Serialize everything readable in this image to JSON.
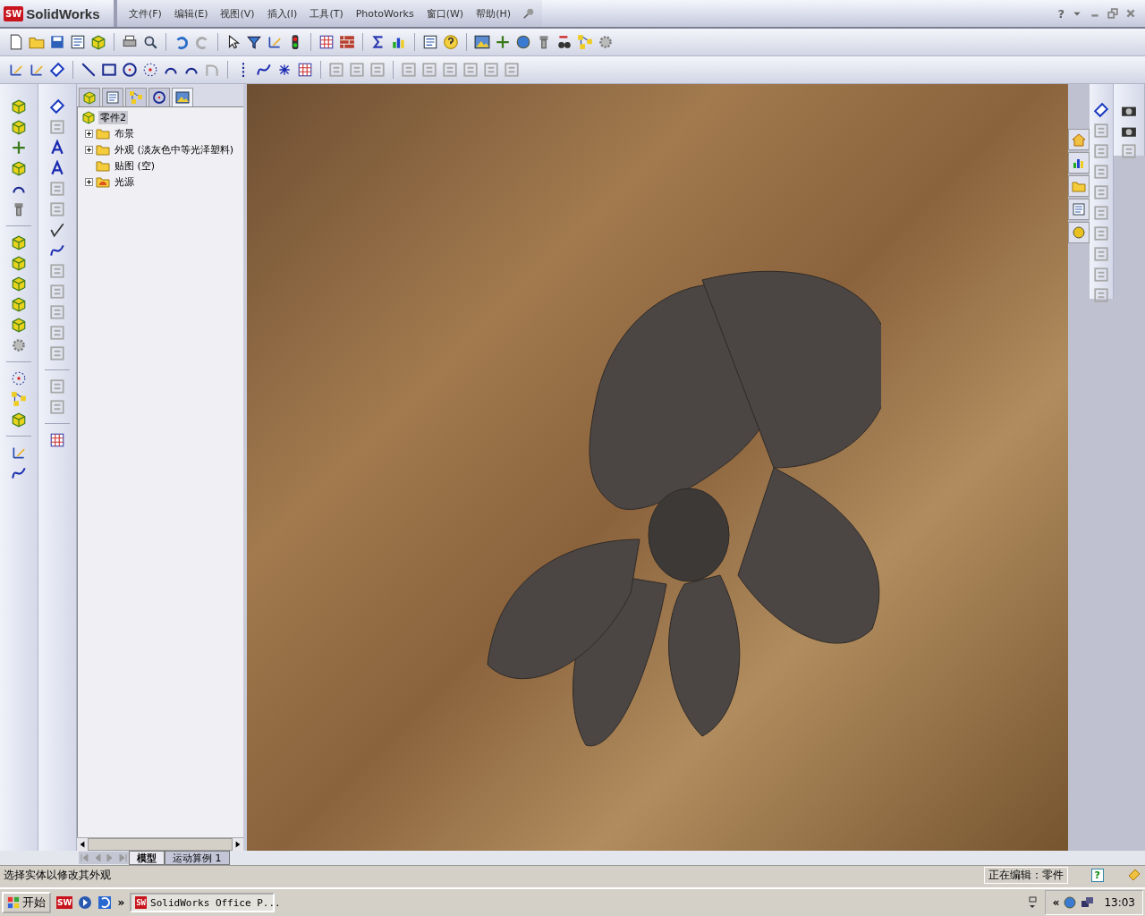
{
  "app": {
    "logo_mark": "SW",
    "logo_text": "SolidWorks"
  },
  "manager_tabs": [
    {
      "selected": false
    },
    {
      "selected": false
    },
    {
      "selected": false
    },
    {
      "selected": false
    },
    {
      "selected": true
    }
  ],
  "menu": [
    "文件(F)",
    "编辑(E)",
    "视图(V)",
    "插入(I)",
    "工具(T)",
    "PhotoWorks",
    "窗口(W)",
    "帮助(H)"
  ],
  "window_controls": {
    "help": "?"
  },
  "feature_tree": {
    "root": {
      "label": "零件2",
      "selected": true
    },
    "items": [
      {
        "label": "布景",
        "kind": "folder",
        "collapsible": true
      },
      {
        "label": "外观 (淡灰色中等光泽塑料)",
        "kind": "folder",
        "collapsible": true
      },
      {
        "label": "贴图 (空)",
        "kind": "folder",
        "collapsible": false
      },
      {
        "label": "光源",
        "kind": "light",
        "collapsible": true
      }
    ]
  },
  "bottom_tabs": [
    {
      "label": "模型",
      "selected": true
    },
    {
      "label": "运动算例 1",
      "selected": false
    }
  ],
  "status_bar": {
    "message": "选择实体以修改其外观",
    "editing": "正在编辑：零件",
    "help": "?"
  },
  "taskbar": {
    "start": "开始",
    "quick_launch_label": "SW",
    "chevron": "»",
    "task_icon": "SW",
    "task": "SolidWorks Office P...",
    "tray_chevron": "«",
    "time": "13:03"
  }
}
